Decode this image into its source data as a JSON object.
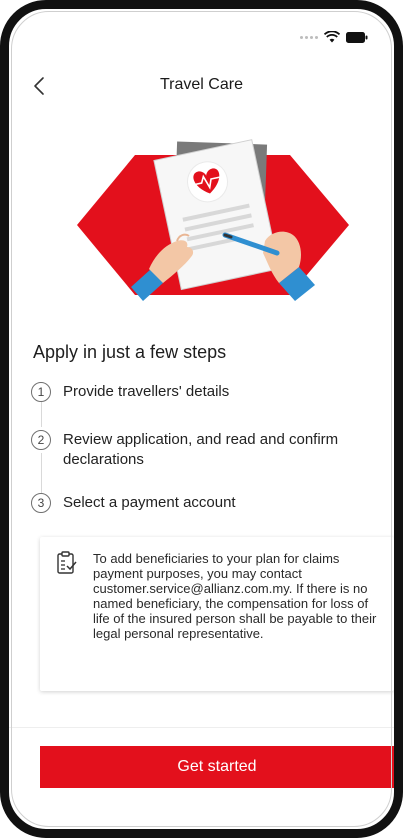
{
  "app": {
    "title": "Travel Care"
  },
  "status_bar": {
    "icons": [
      "signal-dots-icon",
      "wifi-icon",
      "battery-icon"
    ]
  },
  "header": {
    "back_icon": "chevron-left-icon"
  },
  "hero": {
    "image": "application-form-illustration"
  },
  "steps_section": {
    "heading": "Apply in just a few steps",
    "steps": [
      {
        "number": "1",
        "label": "Provide travellers' details"
      },
      {
        "number": "2",
        "label": "Review application, and read and confirm declarations"
      },
      {
        "number": "3",
        "label": "Select a payment account"
      }
    ]
  },
  "info_card": {
    "icon": "clipboard-check-icon",
    "text": "To add beneficiaries to your plan for claims payment purposes, you may contact customer.service@allianz.com.my. If there is no named beneficiary, the compensation for loss of life of the insured person shall be payable to their legal personal representative."
  },
  "cta": {
    "label": "Get started"
  },
  "colors": {
    "primary": "#e3101c",
    "accent_blue": "#2f8fd1",
    "text": "#1e1e1e"
  }
}
